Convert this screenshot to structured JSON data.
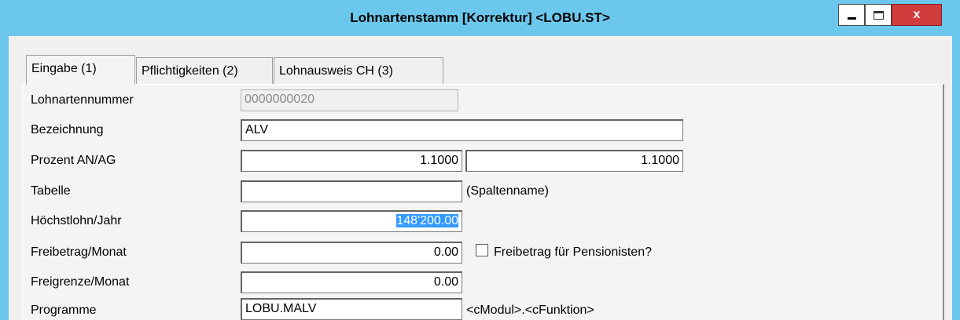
{
  "window": {
    "title": "Lohnartenstamm [Korrektur] <LOBU.ST>",
    "close_glyph": "x",
    "colors": {
      "titlebar": "#6bc8ec",
      "close": "#d13d3d",
      "selection": "#3399ff"
    }
  },
  "tabs": [
    {
      "label": "Eingabe (1)",
      "active": true
    },
    {
      "label": "Pflichtigkeiten (2)",
      "active": false
    },
    {
      "label": "Lohnausweis CH (3)",
      "active": false
    }
  ],
  "form": {
    "lohnartennummer": {
      "label": "Lohnartennummer",
      "value": "0000000020"
    },
    "bezeichnung": {
      "label": "Bezeichnung",
      "value": "ALV"
    },
    "prozent": {
      "label": "Prozent AN/AG",
      "an": "1.1000",
      "ag": "1.1000"
    },
    "tabelle": {
      "label": "Tabelle",
      "value": "",
      "hint": "(Spaltenname)"
    },
    "hoechstlohn": {
      "label": "Höchstlohn/Jahr",
      "value": "148'200.00"
    },
    "freibetrag": {
      "label": "Freibetrag/Monat",
      "value": "0.00",
      "checkbox_label": "Freibetrag für Pensionisten?",
      "checked": false
    },
    "freigrenze": {
      "label": "Freigrenze/Monat",
      "value": "0.00"
    },
    "programme": {
      "label": "Programme",
      "value": "LOBU.MALV",
      "hint": "<cModul>.<cFunktion>"
    }
  }
}
